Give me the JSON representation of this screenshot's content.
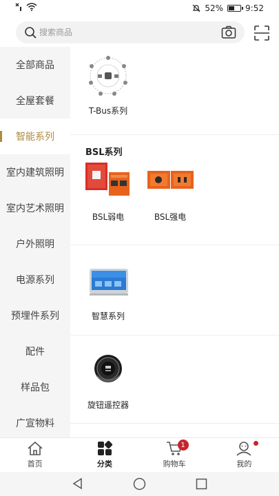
{
  "status_bar": {
    "battery": "52%",
    "time": "9:52",
    "battery_level": 0.52
  },
  "search": {
    "placeholder": "搜索商品"
  },
  "sidebar": {
    "items": [
      {
        "label": "全部商品",
        "active": false
      },
      {
        "label": "全屋套餐",
        "active": false
      },
      {
        "label": "智能系列",
        "active": true
      },
      {
        "label": "室内建筑照明",
        "active": false
      },
      {
        "label": "室内艺术照明",
        "active": false
      },
      {
        "label": "户外照明",
        "active": false
      },
      {
        "label": "电源系列",
        "active": false
      },
      {
        "label": "预埋件系列",
        "active": false
      },
      {
        "label": "配件",
        "active": false
      },
      {
        "label": "样品包",
        "active": false
      },
      {
        "label": "广宣物料",
        "active": false
      }
    ]
  },
  "content": {
    "section1": {
      "items": [
        {
          "label": "T-Bus系列"
        }
      ]
    },
    "section2": {
      "title": "BSL系列",
      "items": [
        {
          "label": "BSL弱电"
        },
        {
          "label": "BSL强电"
        }
      ]
    },
    "section3": {
      "items": [
        {
          "label": "智慧系列"
        }
      ]
    },
    "section4": {
      "items": [
        {
          "label": "旋钮遥控器"
        }
      ]
    }
  },
  "tabbar": {
    "tabs": [
      {
        "label": "首页",
        "icon": "home-icon"
      },
      {
        "label": "分类",
        "icon": "category-icon",
        "active": true
      },
      {
        "label": "购物车",
        "icon": "cart-icon",
        "badge": "1"
      },
      {
        "label": "我的",
        "icon": "profile-icon"
      }
    ]
  },
  "colors": {
    "accent": "#b08a3e",
    "badge": "#c8242b",
    "sidebar_bg": "#f5f5f5",
    "product_orange": "#e8621c"
  }
}
